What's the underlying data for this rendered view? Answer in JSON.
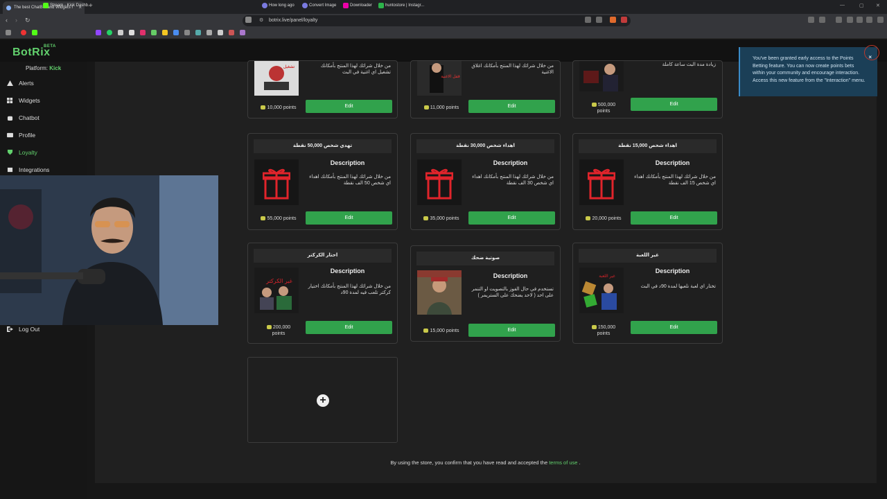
{
  "browser": {
    "tab_title": "The best ChatBot and Widgets f",
    "url": "botrix.live/panel/loyalty",
    "bookmarks": [
      "Stream - Kick Dashb...",
      "How long ago",
      "Convert Image",
      "Downloader",
      "huntostore | Instagr..."
    ]
  },
  "app": {
    "logo": "BotRix",
    "logo_badge": "BETA",
    "platform_label": "Platform:",
    "platform_value": "Kick"
  },
  "sidebar": {
    "items": [
      {
        "label": "Alerts",
        "icon": "warning-icon"
      },
      {
        "label": "Widgets",
        "icon": "grid-icon"
      },
      {
        "label": "Chatbot",
        "icon": "robot-icon"
      },
      {
        "label": "Profile",
        "icon": "id-card-icon"
      },
      {
        "label": "Loyalty",
        "icon": "trophy-icon"
      },
      {
        "label": "Integrations",
        "icon": "plug-icon"
      }
    ],
    "logout": "Log Out"
  },
  "cards": [
    {
      "title": "",
      "desc": "من خلال شرائك لهذا المنتج بأمكانك تشغيل اي اغنية في البث",
      "points": "10,000 points",
      "edit": "Edit"
    },
    {
      "title": "",
      "desc": "من خلال شرائك لهذا المنتج بأمكانك اغلاق الاغنية",
      "points": "11,000 points",
      "edit": "Edit"
    },
    {
      "title": "",
      "desc": "زيادة مدة البث ساعة كاملة",
      "points_line1": "500,000",
      "points_line2": "points",
      "edit": "Edit"
    },
    {
      "title": "تهدي شخص 50,000 نقطة",
      "desc_head": "Description",
      "desc": "من خلال شرائك لهذا المنتج بأمكانك اهداء اي شخص 50 الف نقطة",
      "points": "55,000 points",
      "edit": "Edit"
    },
    {
      "title": "اهداء شخص 30,000 نقطة",
      "desc_head": "Description",
      "desc": "من خلال شرائك لهذا المنتج بأمكانك اهداء اي شخص 30 الف نقطة",
      "points": "35,000 points",
      "edit": "Edit"
    },
    {
      "title": "اهداء شخص 15,000 نقطة",
      "desc_head": "Description",
      "desc": "من خلال شرائك لهذا المنتج بأمكانك اهداء اي شخص 15 الف نقطة",
      "points": "20,000 points",
      "edit": "Edit"
    },
    {
      "title": "احتار الكركتر",
      "desc_head": "Description",
      "desc": "من خلال شرائك لهذا المنتج بأمكانك اختيار كركتر تلعب فيه لمدة 90د",
      "points_line1": "200,000",
      "points_line2": "points",
      "edit": "Edit"
    },
    {
      "title": "صوتية ضحك",
      "desc_head": "Description",
      "desc": "تستخدم في حال الفوز بالتصويت او التنمر على احد ( لاحد يضحك على الستريمر )",
      "points": "15,000 points",
      "edit": "Edit"
    },
    {
      "title": "غير اللعبة",
      "desc_head": "Description",
      "desc": "تختار اي لعبة نلعبها لمدة 90د في البث",
      "points_line1": "150,000",
      "points_line2": "points",
      "edit": "Edit"
    }
  ],
  "card_images": {
    "img1_text": "تشغيل",
    "img2_text": "قفل الاغنية",
    "img7_text": "غير الكركتر",
    "img9_text": "غير اللعبة"
  },
  "footer": {
    "text": "By using the store, you confirm that you have read and accepted the",
    "link": "terms of use",
    "end": "."
  },
  "toast": {
    "message": "You've been granted early access to the Points Betting feature. You can now create points bets within your community and encourage interaction. Access this new feature from the \"Interaction\" menu.",
    "close": "×"
  },
  "colors": {
    "accent": "#62d16d",
    "button": "#31a24c",
    "toast_bg": "#1b3f57"
  }
}
